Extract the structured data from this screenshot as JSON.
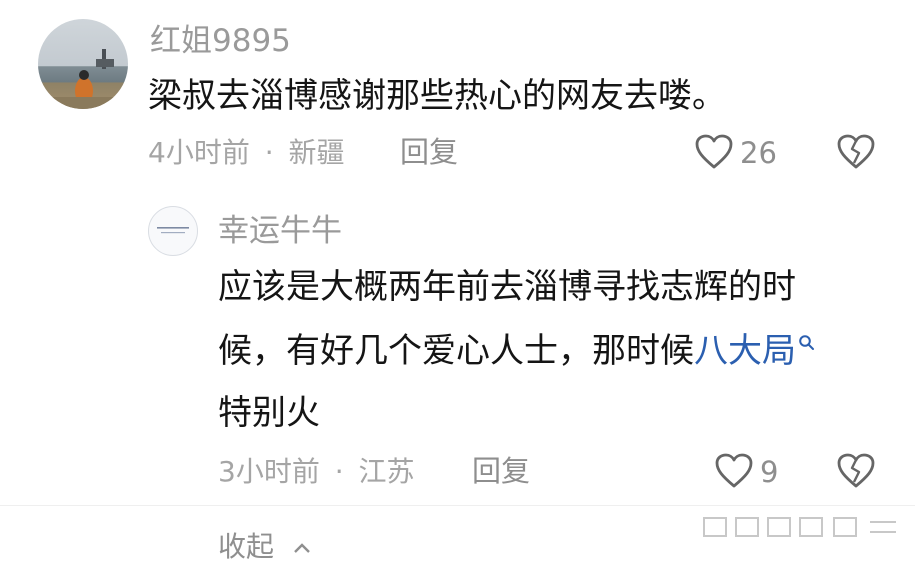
{
  "comment": {
    "username": "红姐9895",
    "text": "梁叔去淄博感谢那些热心的网友去喽。",
    "time": "4小时前",
    "separator": "·",
    "location": "新疆",
    "reply_label": "回复",
    "like_count": "26"
  },
  "reply": {
    "username": "幸运牛牛",
    "line1": "应该是大概两年前去淄博寻找志辉的时",
    "line2_prefix": "候，有好几个爱心人士，那时候",
    "line2_link": "八大局",
    "line3": "特别火",
    "time": "3小时前",
    "separator": "·",
    "location": "江苏",
    "reply_label": "回复",
    "like_count": "9"
  },
  "footer": {
    "collapse_label": "收起"
  },
  "colors": {
    "link": "#2b5fb0",
    "meta": "#a5a5a5"
  },
  "icons": [
    "heart-outline-icon",
    "broken-heart-icon",
    "search-icon",
    "chevron-up-icon"
  ]
}
